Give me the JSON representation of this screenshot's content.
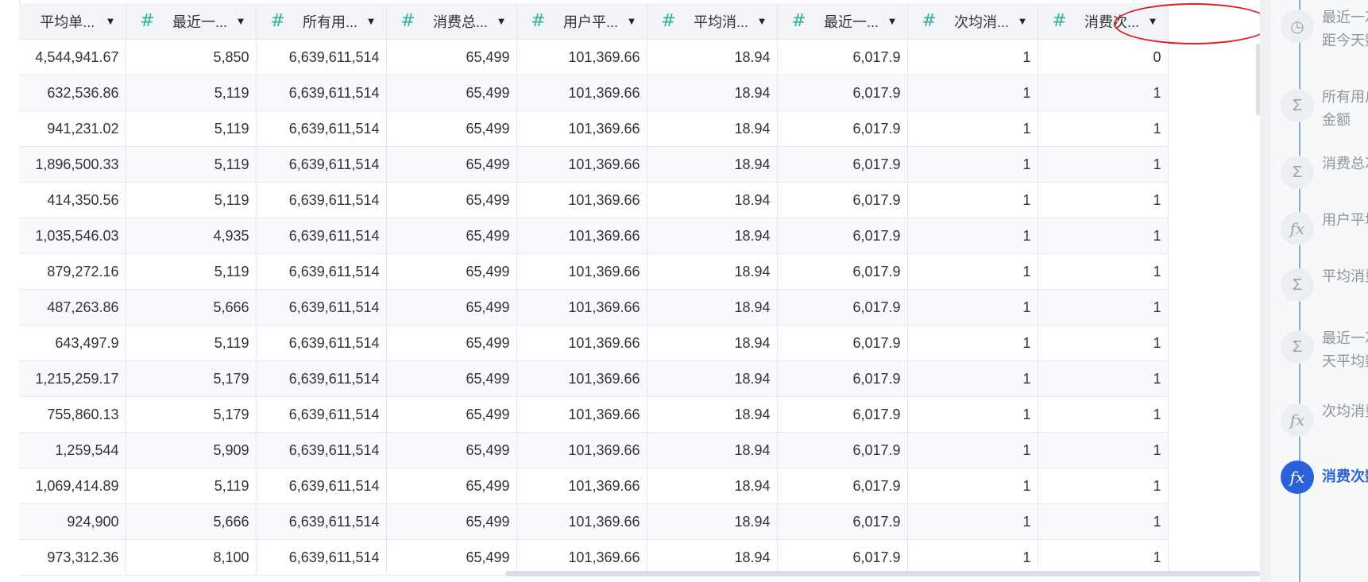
{
  "table": {
    "columns": [
      {
        "label": "平均单..."
      },
      {
        "label": "最近一..."
      },
      {
        "label": "所有用..."
      },
      {
        "label": "消费总..."
      },
      {
        "label": "用户平..."
      },
      {
        "label": "平均消..."
      },
      {
        "label": "最近一..."
      },
      {
        "label": "次均消..."
      },
      {
        "label": "消费次..."
      }
    ],
    "rows": [
      [
        "4,544,941.67",
        "5,850",
        "6,639,611,514",
        "65,499",
        "101,369.66",
        "18.94",
        "6,017.9",
        "1",
        "0"
      ],
      [
        "632,536.86",
        "5,119",
        "6,639,611,514",
        "65,499",
        "101,369.66",
        "18.94",
        "6,017.9",
        "1",
        "1"
      ],
      [
        "941,231.02",
        "5,119",
        "6,639,611,514",
        "65,499",
        "101,369.66",
        "18.94",
        "6,017.9",
        "1",
        "1"
      ],
      [
        "1,896,500.33",
        "5,119",
        "6,639,611,514",
        "65,499",
        "101,369.66",
        "18.94",
        "6,017.9",
        "1",
        "1"
      ],
      [
        "414,350.56",
        "5,119",
        "6,639,611,514",
        "65,499",
        "101,369.66",
        "18.94",
        "6,017.9",
        "1",
        "1"
      ],
      [
        "1,035,546.03",
        "4,935",
        "6,639,611,514",
        "65,499",
        "101,369.66",
        "18.94",
        "6,017.9",
        "1",
        "1"
      ],
      [
        "879,272.16",
        "5,119",
        "6,639,611,514",
        "65,499",
        "101,369.66",
        "18.94",
        "6,017.9",
        "1",
        "1"
      ],
      [
        "487,263.86",
        "5,666",
        "6,639,611,514",
        "65,499",
        "101,369.66",
        "18.94",
        "6,017.9",
        "1",
        "1"
      ],
      [
        "643,497.9",
        "5,119",
        "6,639,611,514",
        "65,499",
        "101,369.66",
        "18.94",
        "6,017.9",
        "1",
        "1"
      ],
      [
        "1,215,259.17",
        "5,179",
        "6,639,611,514",
        "65,499",
        "101,369.66",
        "18.94",
        "6,017.9",
        "1",
        "1"
      ],
      [
        "755,860.13",
        "5,179",
        "6,639,611,514",
        "65,499",
        "101,369.66",
        "18.94",
        "6,017.9",
        "1",
        "1"
      ],
      [
        "1,259,544",
        "5,909",
        "6,639,611,514",
        "65,499",
        "101,369.66",
        "18.94",
        "6,017.9",
        "1",
        "1"
      ],
      [
        "1,069,414.89",
        "5,119",
        "6,639,611,514",
        "65,499",
        "101,369.66",
        "18.94",
        "6,017.9",
        "1",
        "1"
      ],
      [
        "924,900",
        "5,666",
        "6,639,611,514",
        "65,499",
        "101,369.66",
        "18.94",
        "6,017.9",
        "1",
        "1"
      ],
      [
        "973,312.36",
        "8,100",
        "6,639,611,514",
        "65,499",
        "101,369.66",
        "18.94",
        "6,017.9",
        "1",
        "1"
      ]
    ]
  },
  "field_panel": {
    "items": [
      {
        "icon": "clock-icon",
        "lines": [
          "最近一次",
          "距今天数"
        ]
      },
      {
        "icon": "sigma-icon",
        "lines": [
          "所有用户",
          "金额"
        ]
      },
      {
        "icon": "sigma-icon",
        "lines": [
          "消费总次"
        ]
      },
      {
        "icon": "fx-icon",
        "lines": [
          "用户平均"
        ]
      },
      {
        "icon": "sigma-icon",
        "lines": [
          "平均消费"
        ]
      },
      {
        "icon": "sigma-icon",
        "lines": [
          "最近一次",
          "天平均数"
        ]
      },
      {
        "icon": "fx-icon",
        "lines": [
          "次均消费"
        ]
      },
      {
        "icon": "fx-icon",
        "lines": [
          "消费次数"
        ],
        "active": true
      }
    ]
  },
  "colors": {
    "accent": "#2b62d9",
    "number_icon": "#2fb39a",
    "highlight_circle": "#e01b24"
  }
}
